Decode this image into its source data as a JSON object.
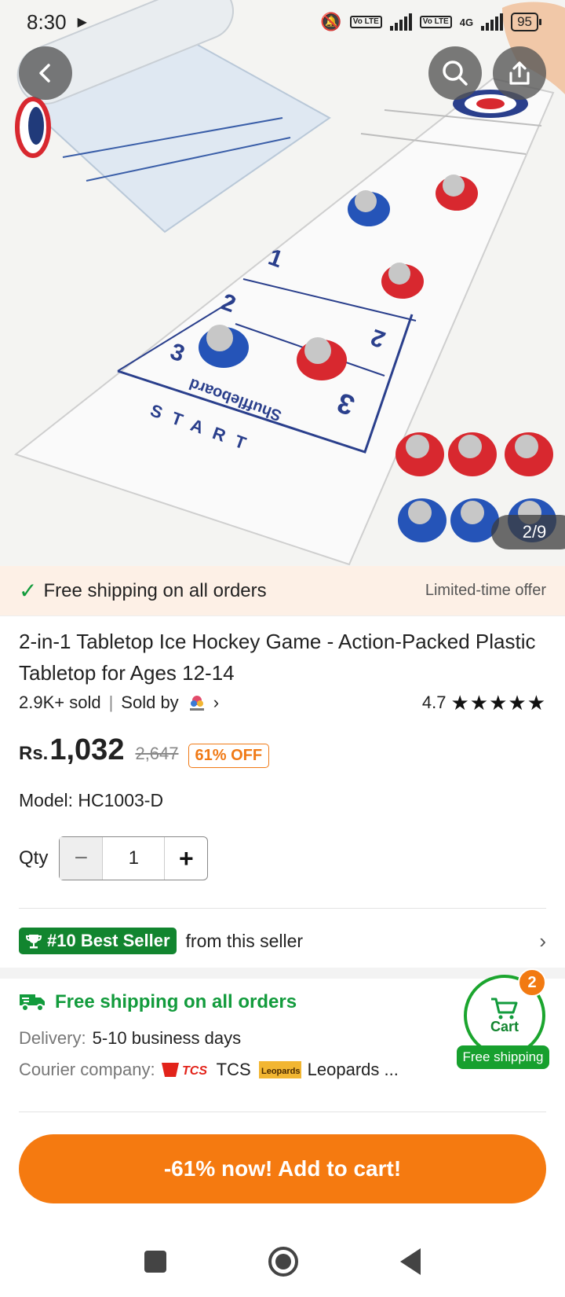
{
  "status_bar": {
    "time": "8:30",
    "battery": "95",
    "network": "4G",
    "volte": "Vo LTE"
  },
  "hero": {
    "image_counter": "2/9",
    "board_text": "Shuffleboard",
    "start_text": "START",
    "lane_numbers": [
      "1",
      "2",
      "3"
    ]
  },
  "promo_strip": {
    "text": "Free shipping on all orders",
    "offer": "Limited-time offer"
  },
  "product": {
    "title": "2-in-1 Tabletop Ice Hockey Game - Action-Packed Plastic Tabletop for Ages 12-14",
    "sold": "2.9K+ sold",
    "sep": "|",
    "sold_by": "Sold by",
    "rating": "4.7",
    "stars": "★★★★★",
    "currency": "Rs.",
    "price": "1,032",
    "original_price": "2,647",
    "discount": "61% OFF",
    "model": "Model: HC1003-D"
  },
  "quantity": {
    "label": "Qty",
    "value": "1",
    "minus": "−",
    "plus": "+"
  },
  "bestseller": {
    "badge": "#10 Best Seller",
    "text": "from this seller"
  },
  "shipping": {
    "title": "Free shipping on all orders",
    "delivery_label": "Delivery:",
    "delivery_value": "5-10 business days",
    "courier_label": "Courier company:",
    "courier_1": "TCS",
    "courier_2": "Leopards ...",
    "courier_1_logo": "TCS",
    "courier_2_logo": "Leopards"
  },
  "cart": {
    "label": "Cart",
    "count": "2",
    "shipping": "Free shipping"
  },
  "cta": {
    "label": "-61% now! Add to cart!"
  },
  "colors": {
    "accent_orange": "#f57a10",
    "green": "#129b3c",
    "promo_bg": "#fdf0e6"
  }
}
